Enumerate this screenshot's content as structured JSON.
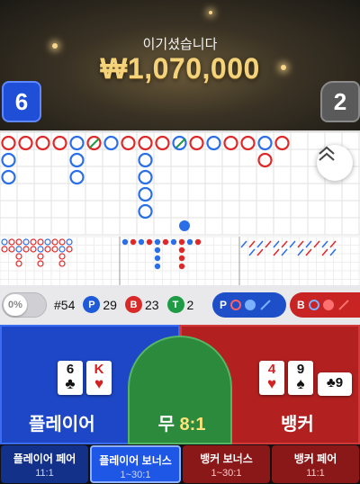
{
  "banner": {
    "win_label": "이기셨습니다",
    "win_amount": "₩1,070,000",
    "player_score": "6",
    "banker_score": "2"
  },
  "stats": {
    "percent": "0%",
    "round": "#54",
    "player_label": "P",
    "player_count": "29",
    "banker_label": "B",
    "banker_count": "23",
    "tie_label": "T",
    "tie_count": "2",
    "predict_player": "P",
    "predict_banker": "B"
  },
  "bets": {
    "player_label": "플레이어",
    "banker_label": "뱅커",
    "tie_label": "무",
    "tie_odds": "8:1",
    "player_cards": [
      {
        "rank": "6",
        "suit": "♣",
        "color": "#111111"
      },
      {
        "rank": "K",
        "suit": "♥",
        "color": "#d32020"
      }
    ],
    "banker_cards": [
      {
        "rank": "4",
        "suit": "♥",
        "color": "#d32020"
      },
      {
        "rank": "9",
        "suit": "♠",
        "color": "#111111"
      },
      {
        "rank": "9",
        "suit": "♣",
        "color": "#111111"
      }
    ]
  },
  "side_bets": [
    {
      "name": "플레이어 페어",
      "odds": "11:1"
    },
    {
      "name": "플레이어 보너스",
      "odds": "1~30:1"
    },
    {
      "name": "뱅커 보너스",
      "odds": "1~30:1"
    },
    {
      "name": "뱅커 페어",
      "odds": "11:1"
    }
  ],
  "colors": {
    "player": "#1d47c7",
    "banker": "#b32020",
    "tie": "#2c8a3c",
    "gold": "#f4d37a"
  },
  "icons": {
    "collapse": "chevron-double-up-icon"
  }
}
